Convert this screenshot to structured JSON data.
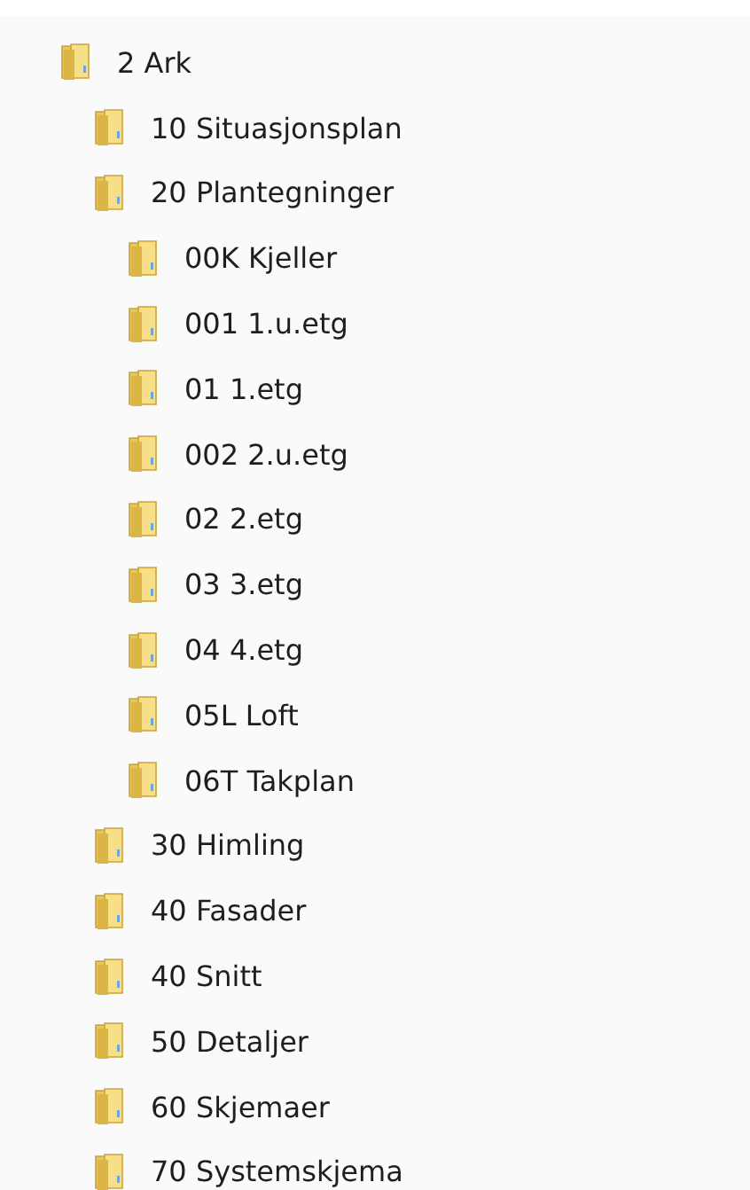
{
  "tree": [
    {
      "label": "2 Ark",
      "children": [
        {
          "label": "10 Situasjonsplan"
        },
        {
          "label": "20 Plantegninger",
          "children": [
            {
              "label": "00K Kjeller"
            },
            {
              "label": "001 1.u.etg"
            },
            {
              "label": "01 1.etg"
            },
            {
              "label": "002 2.u.etg"
            },
            {
              "label": "02 2.etg"
            },
            {
              "label": "03 3.etg"
            },
            {
              "label": "04 4.etg"
            },
            {
              "label": "05L Loft"
            },
            {
              "label": "06T Takplan"
            }
          ]
        },
        {
          "label": "30 Himling"
        },
        {
          "label": "40 Fasader"
        },
        {
          "label": "40 Snitt"
        },
        {
          "label": "50 Detaljer"
        },
        {
          "label": "60 Skjemaer"
        },
        {
          "label": "70 Systemskjema"
        }
      ]
    }
  ]
}
